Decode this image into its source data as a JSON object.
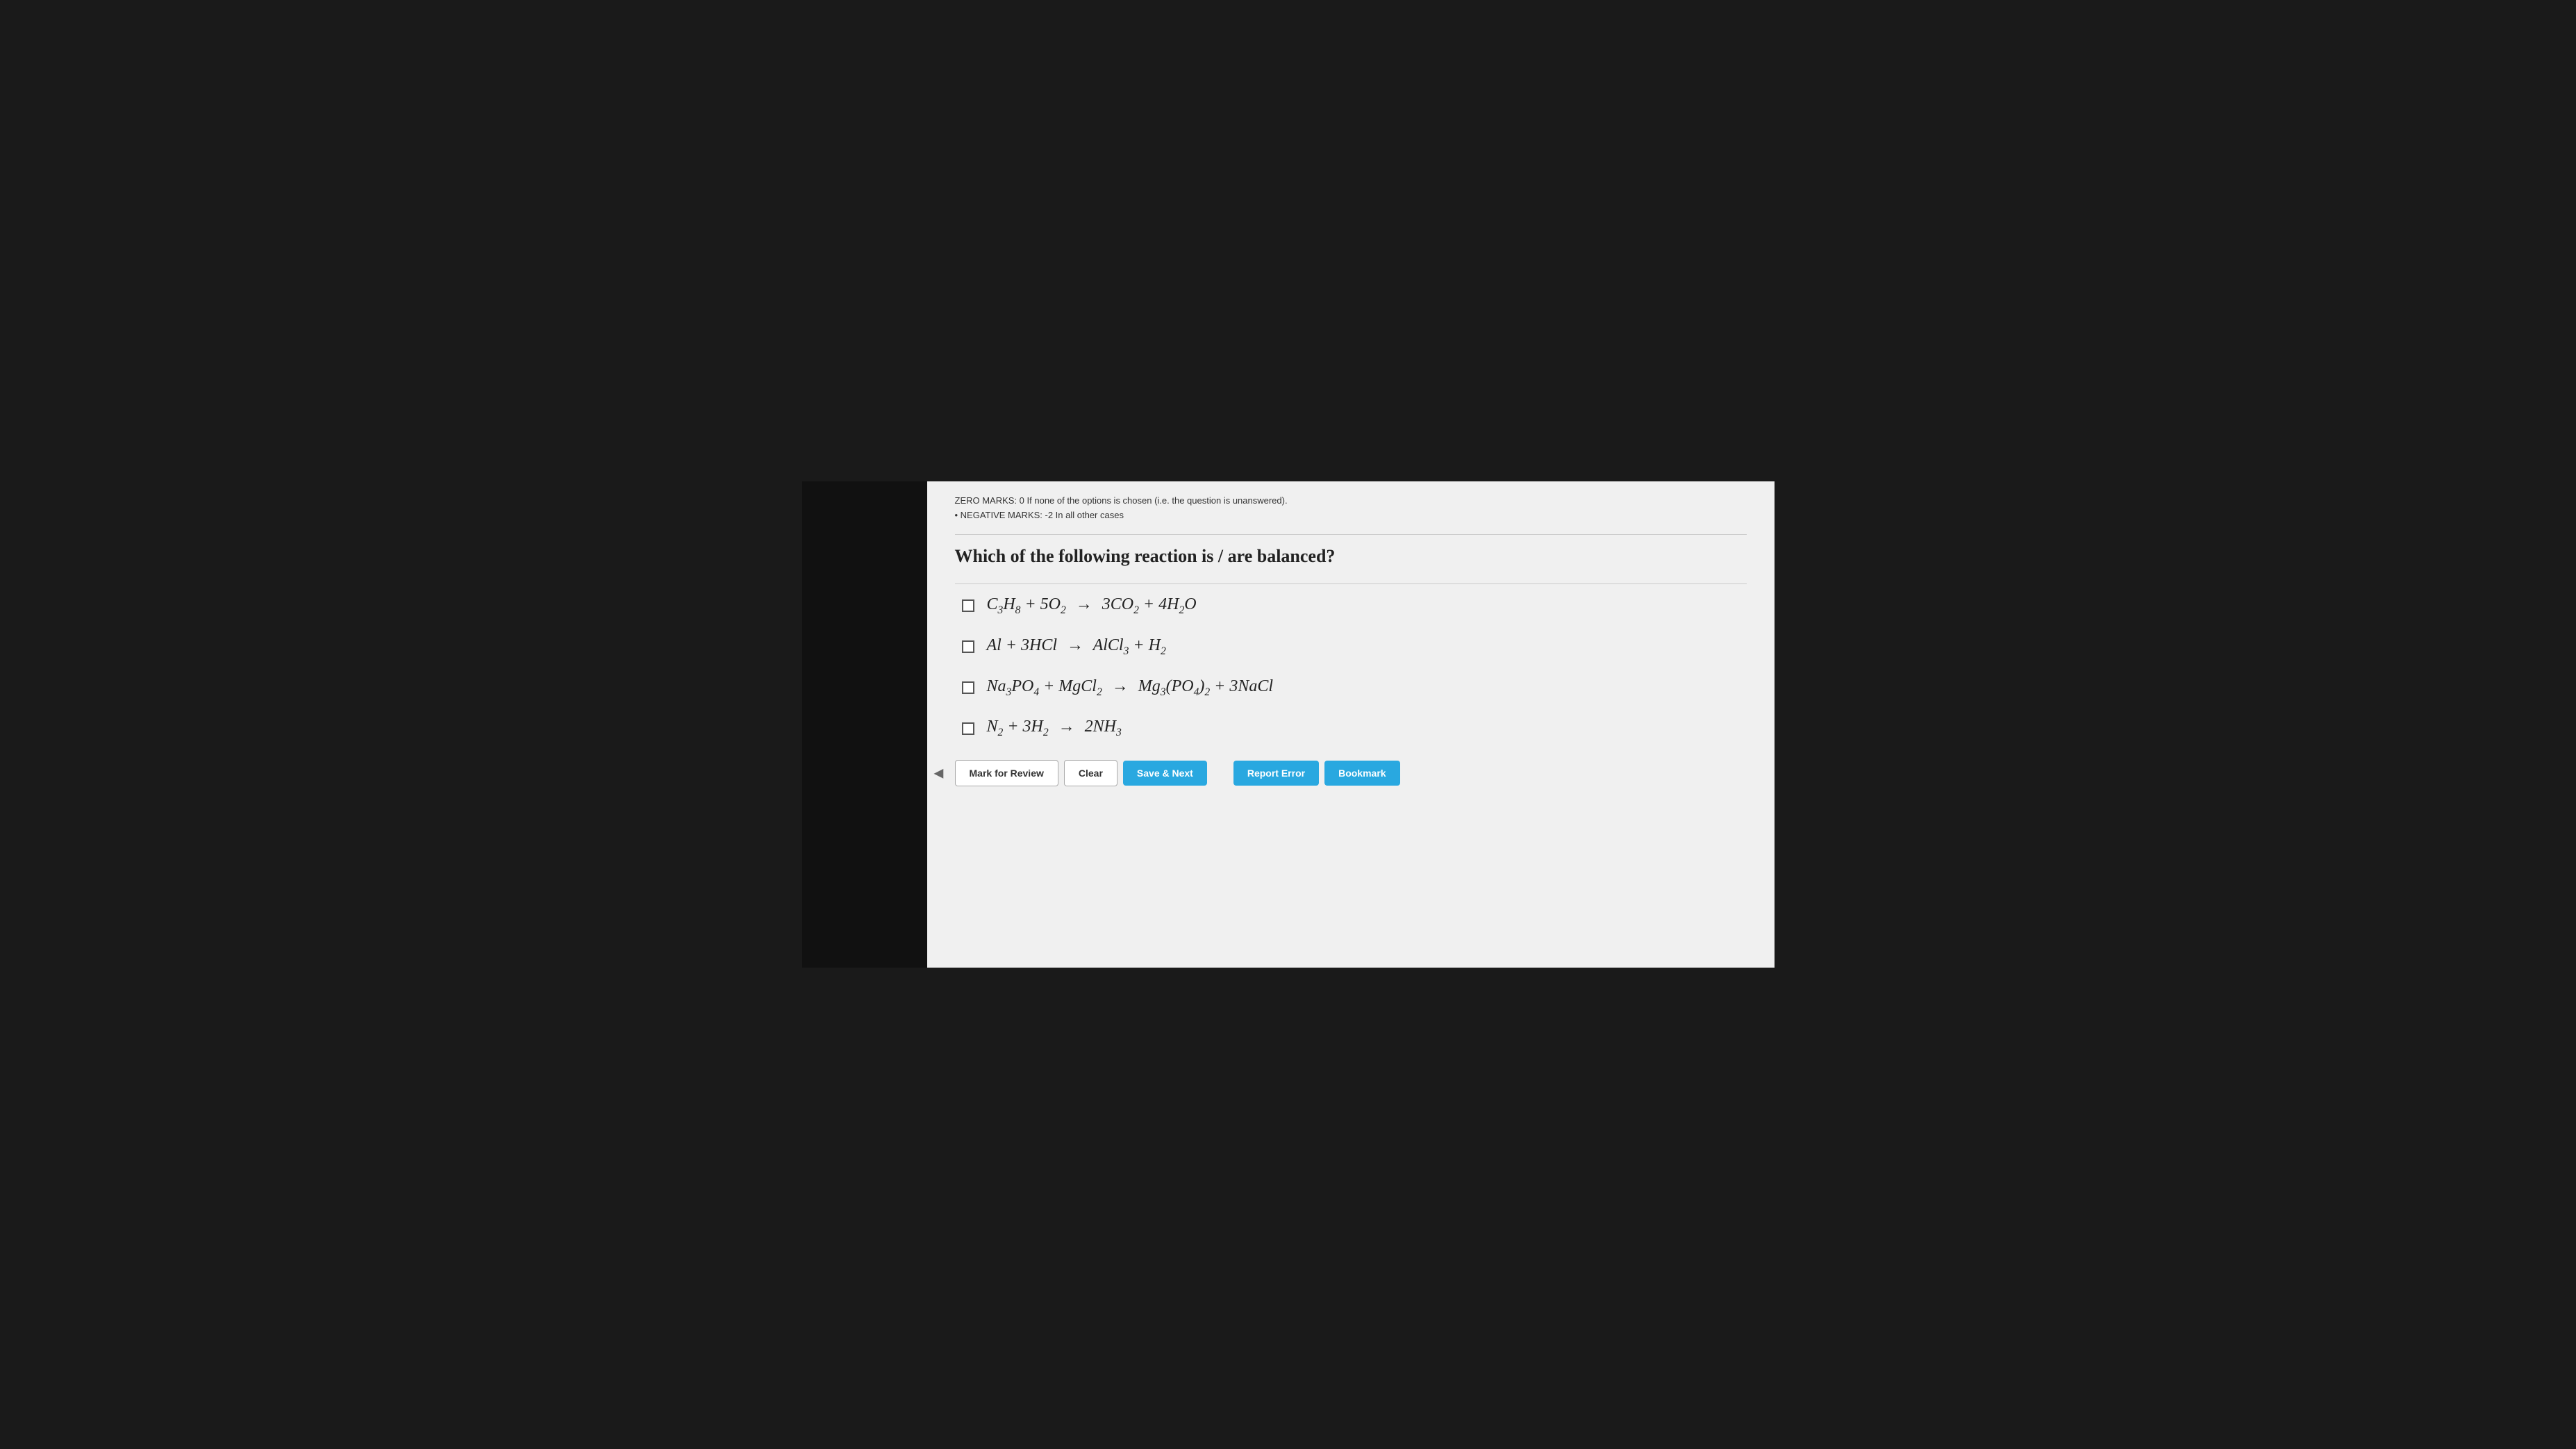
{
  "info": {
    "zero_marks_text": "ZERO MARKS: 0 If none of the options is chosen (i.e. the question is unanswered).",
    "negative_marks_text": "NEGATIVE MARKS: -2 In all other cases"
  },
  "question": {
    "text": "Which of the following reaction is / are balanced?"
  },
  "options": [
    {
      "id": "A",
      "html_label": "C₃H₈ + 5O₂ → 3CO₂ + 4H₂O"
    },
    {
      "id": "B",
      "html_label": "Al + 3HCl → AlCl₃ + H₂"
    },
    {
      "id": "C",
      "html_label": "Na₃PO₄ + MgCl₂ → Mg₃(PO₄)₂ + 3NaCl"
    },
    {
      "id": "D",
      "html_label": "N₂ + 3H₂ → 2NH₃"
    }
  ],
  "buttons": {
    "mark_for_review": "Mark for Review",
    "clear": "Clear",
    "save_next": "Save & Next",
    "report_error": "Report Error",
    "bookmark": "Bookmark"
  }
}
